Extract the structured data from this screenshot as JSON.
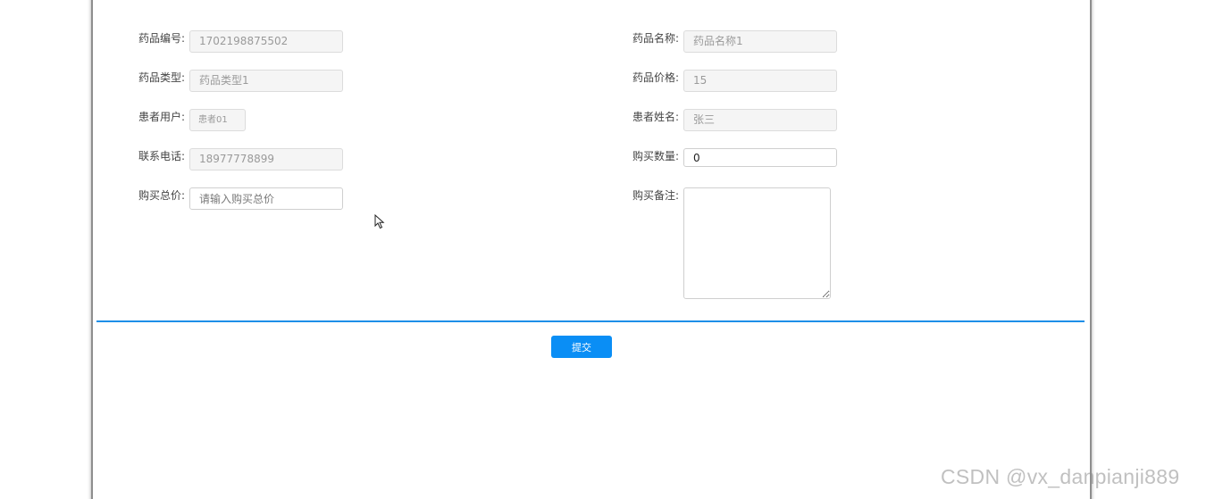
{
  "form": {
    "drug_code_label": "药品编号:",
    "drug_code_value": "1702198875502",
    "drug_name_label": "药品名称:",
    "drug_name_value": "药品名称1",
    "drug_type_label": "药品类型:",
    "drug_type_value": "药品类型1",
    "drug_price_label": "药品价格:",
    "drug_price_value": "15",
    "patient_user_label": "患者用户:",
    "patient_user_value": "患者01",
    "patient_name_label": "患者姓名:",
    "patient_name_value": "张三",
    "phone_label": "联系电话:",
    "phone_value": "18977778899",
    "quantity_label": "购买数量:",
    "quantity_value": "0",
    "total_label": "购买总价:",
    "total_placeholder": "请输入购买总价",
    "remarks_label": "购买备注:",
    "remarks_value": ""
  },
  "actions": {
    "submit_label": "提交"
  },
  "watermark": {
    "text": "CSDN @vx_danpianji889"
  },
  "colors": {
    "accent": "#0a8ef5",
    "divider": "#1e8fe8",
    "readonly_bg": "#f5f5f5"
  },
  "icons": {
    "cursor": "mouse-pointer-icon"
  }
}
